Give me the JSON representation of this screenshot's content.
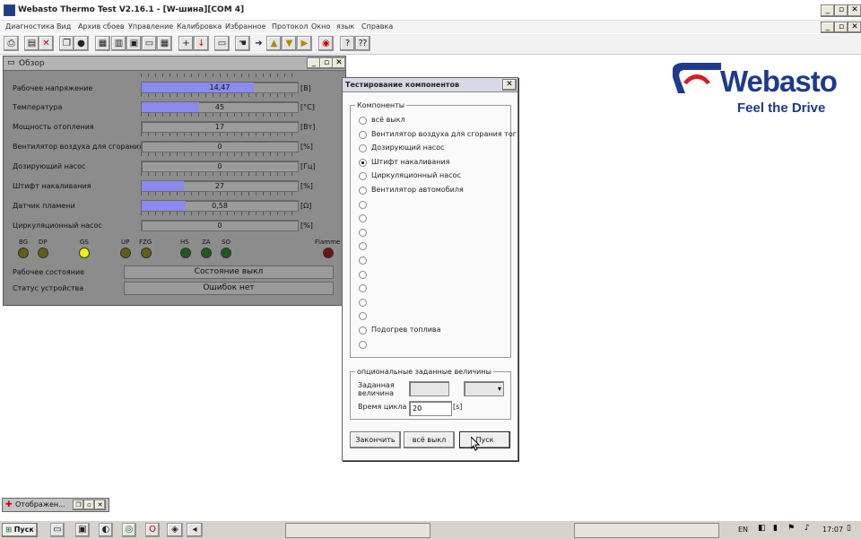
{
  "window": {
    "title": "Webasto Thermo Test V2.16.1 - [W-шина][COM 4]"
  },
  "menu": [
    "Диагностика",
    "Вид",
    "Архив сбоев",
    "Управление",
    "Калибровка",
    "Избранное",
    "Протокол",
    "Окно",
    "язык",
    "Справка"
  ],
  "overview": {
    "title": "Обзор",
    "rows": [
      {
        "label": "Рабочее напряжение",
        "value": "14,47",
        "unit": "[В]",
        "fill": 0.72
      },
      {
        "label": "Температура",
        "value": "45",
        "unit": "[°C]",
        "fill": 0.37
      },
      {
        "label": "Мощность отопления",
        "value": "17",
        "unit": "[Вт]",
        "fill": 0.0
      },
      {
        "label": "Вентилятор воздуха для сгорания то",
        "value": "0",
        "unit": "[%]",
        "fill": 0.0
      },
      {
        "label": "Дозирующий насос",
        "value": "0",
        "unit": "[Гц]",
        "fill": 0.0
      },
      {
        "label": "Штифт накаливания",
        "value": "27",
        "unit": "[%]",
        "fill": 0.27
      },
      {
        "label": "Датчик пламени",
        "value": "0,58",
        "unit": "[Ω]",
        "fill": 0.28
      },
      {
        "label": "Циркуляционный насос",
        "value": "0",
        "unit": "[%]",
        "fill": 0.0
      }
    ],
    "leds": [
      {
        "label": "BG",
        "color": "#5f5f1a"
      },
      {
        "label": "DP",
        "color": "#5f5f1a"
      },
      {
        "label": "GS",
        "color": "#f2f20a"
      },
      {
        "label": "UP",
        "color": "#5f5f1a"
      },
      {
        "label": "FZG",
        "color": "#5f5f1a"
      },
      {
        "label": "HS",
        "color": "#1f5a1f"
      },
      {
        "label": "ZA",
        "color": "#1f5a1f"
      },
      {
        "label": "SO",
        "color": "#1f5a1f"
      },
      {
        "label": "Flamme",
        "color": "#6a1414"
      }
    ],
    "status": [
      {
        "label": "Рабочее состояние",
        "value": "Состояние выкл"
      },
      {
        "label": "Статус устройства",
        "value": "Ошибок нет"
      }
    ]
  },
  "dialog": {
    "title": "Тестирование компонентов",
    "group_label": "Компоненты",
    "components": [
      {
        "label": "всё выкл",
        "selected": false
      },
      {
        "label": "Вентилятор воздуха для сгорания тог",
        "selected": false
      },
      {
        "label": "Дозирующий насос",
        "selected": false
      },
      {
        "label": "Штифт накаливания",
        "selected": true
      },
      {
        "label": "Циркуляционный насос",
        "selected": false
      },
      {
        "label": "Вентилятор автомобиля",
        "selected": false
      },
      {
        "label": "",
        "selected": false
      },
      {
        "label": "",
        "selected": false
      },
      {
        "label": "",
        "selected": false
      },
      {
        "label": "",
        "selected": false
      },
      {
        "label": "",
        "selected": false
      },
      {
        "label": "",
        "selected": false
      },
      {
        "label": "",
        "selected": false
      },
      {
        "label": "",
        "selected": false
      },
      {
        "label": "",
        "selected": false
      },
      {
        "label": "Подогрев топлива",
        "selected": false
      },
      {
        "label": "",
        "selected": false
      }
    ],
    "optional_label": "опциональные заданные величины",
    "setpoint_label": "Заданная величина",
    "cycle_label": "Время цикла",
    "cycle_value": "20",
    "cycle_unit": "[s]",
    "buttons": {
      "finish": "Закончить",
      "all_off": "всё выкл",
      "start": "Пуск"
    }
  },
  "logo": {
    "word": "Webasto",
    "tagline": "Feel the Drive",
    "brand_color": "#1d3a8c",
    "accent": "#d21f26"
  },
  "minimized_window": {
    "title": "Отображен..."
  },
  "taskbar": {
    "start": "Пуск",
    "lang": "EN",
    "clock": "17:07"
  }
}
